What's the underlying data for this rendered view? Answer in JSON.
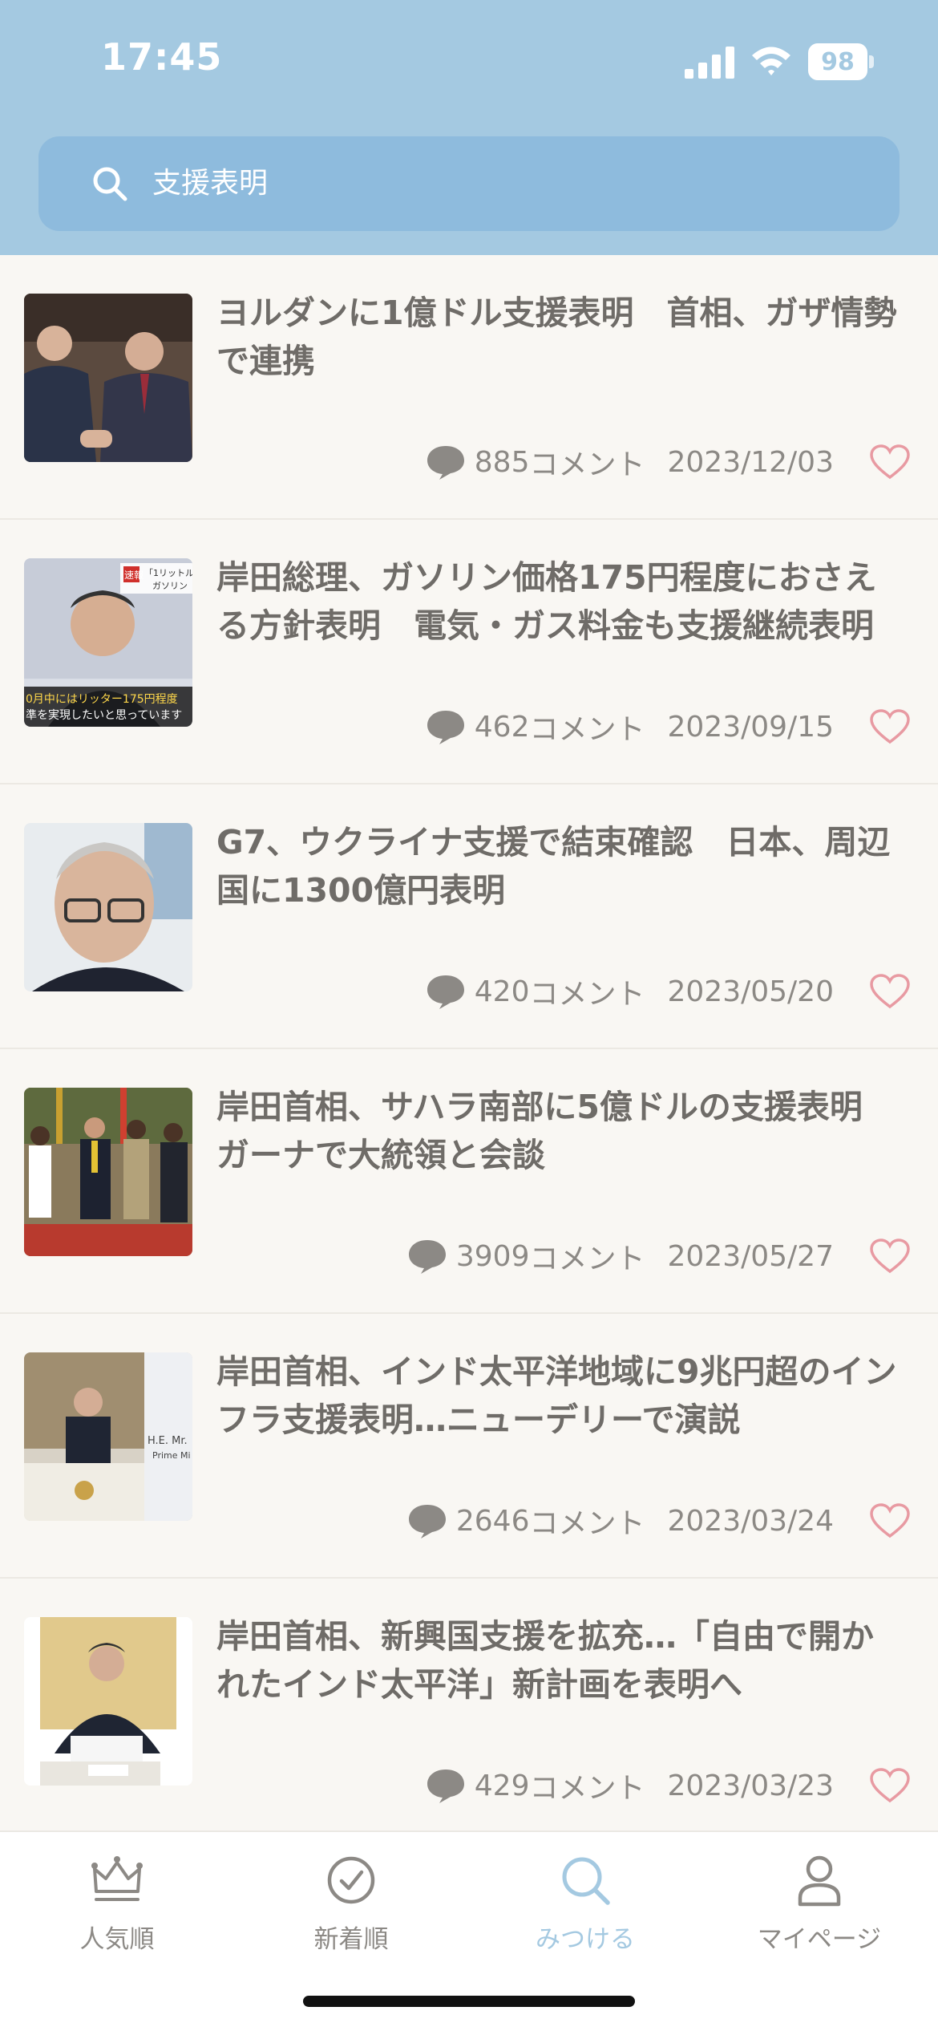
{
  "status": {
    "time": "17:45",
    "battery": "98"
  },
  "search": {
    "query": "支援表明"
  },
  "articles": [
    {
      "title": "ヨルダンに1億ドル支援表明　首相、ガザ情勢で連携",
      "comments": "885",
      "suffix": "コメント",
      "date": "2023/12/03"
    },
    {
      "title": "岸田総理、ガソリン価格175円程度におさえる方針表明　電気・ガス料金も支援継続表明",
      "comments": "462",
      "suffix": "コメント",
      "date": "2023/09/15",
      "thumb_caption_top": "「1リットル",
      "thumb_caption_mid": "ガソリン",
      "thumb_badge": "速報",
      "thumb_caption_line1": "0月中にはリッター175円程度",
      "thumb_caption_line2": "準を実現したいと思っています"
    },
    {
      "title": "G7、ウクライナ支援で結束確認　日本、周辺国に1300億円表明",
      "comments": "420",
      "suffix": "コメント",
      "date": "2023/05/20"
    },
    {
      "title": "岸田首相、サハラ南部に5億ドルの支援表明　ガーナで大統領と会談",
      "comments": "3909",
      "suffix": "コメント",
      "date": "2023/05/27"
    },
    {
      "title": "岸田首相、インド太平洋地域に9兆円超のインフラ支援表明…ニューデリーで演説",
      "comments": "2646",
      "suffix": "コメント",
      "date": "2023/03/24",
      "thumb_caption_line1": "H.E. Mr.",
      "thumb_caption_line2": "Prime Mi"
    },
    {
      "title": "岸田首相、新興国支援を拡充…「自由で開かれたインド太平洋」新計画を表明へ",
      "comments": "429",
      "suffix": "コメント",
      "date": "2023/03/23"
    }
  ],
  "tabs": [
    {
      "label": "人気順",
      "icon": "crown-icon"
    },
    {
      "label": "新着順",
      "icon": "clock-icon"
    },
    {
      "label": "みつける",
      "icon": "search-icon"
    },
    {
      "label": "マイページ",
      "icon": "person-icon"
    }
  ],
  "colors": {
    "header": "#a4c9e1",
    "search_bar": "#8ebbdd",
    "active_tab": "#a4c9e1",
    "heart": "#e89aa2",
    "background": "#f9f7f3"
  }
}
